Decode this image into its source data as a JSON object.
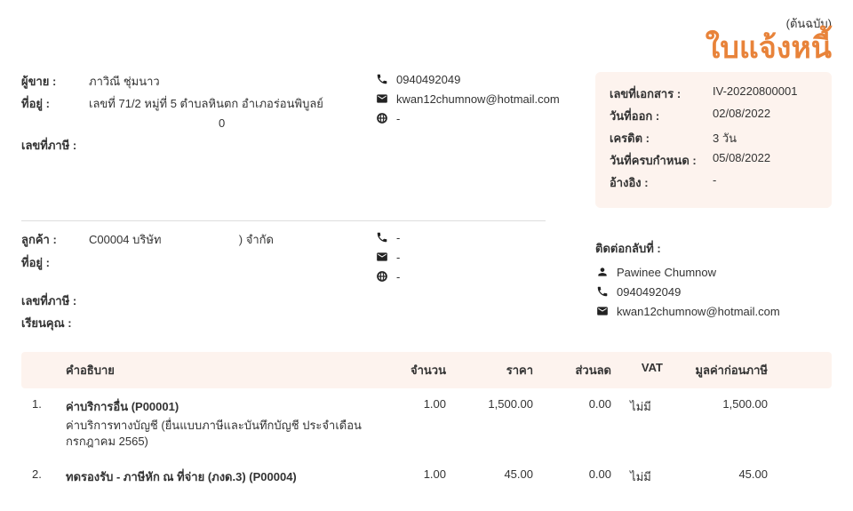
{
  "header": {
    "original": "(ต้นฉบับ)",
    "title": "ใบแจ้งหนี้"
  },
  "seller": {
    "labels": {
      "name": "ผู้ขาย :",
      "address": "ที่อยู่ :",
      "taxid": "เลขที่ภาษี :"
    },
    "name": "ภาวิณี ชุ่มนาว",
    "address_line1": "เลขที่ 71/2 หมู่ที่ 5 ตำบลหินตก อำเภอร่อนพิบูลย์",
    "address_line2_visible": "0",
    "phone": "0940492049",
    "email": "kwan12chumnow@hotmail.com",
    "web": "-"
  },
  "customer": {
    "labels": {
      "name": "ลูกค้า :",
      "address": "ที่อยู่ :",
      "taxid": "เลขที่ภาษี :",
      "attn": "เรียนคุณ :"
    },
    "name_prefix": "C00004 บริษัท",
    "name_suffix": ") จำกัด",
    "phone": "-",
    "email": "-",
    "web": "-"
  },
  "docinfo": {
    "labels": {
      "docno": "เลขที่เอกสาร :",
      "issue": "วันที่ออก :",
      "credit": "เครดิต :",
      "due": "วันที่ครบกำหนด :",
      "ref": "อ้างอิง :"
    },
    "docno": "IV-20220800001",
    "issue": "02/08/2022",
    "credit": "3 วัน",
    "due": "05/08/2022",
    "ref": "-"
  },
  "contactback": {
    "title": "ติดต่อกลับที่ :",
    "name": "Pawinee Chumnow",
    "phone": "0940492049",
    "email": "kwan12chumnow@hotmail.com"
  },
  "table": {
    "headers": {
      "desc": "คำอธิบาย",
      "qty": "จำนวน",
      "price": "ราคา",
      "discount": "ส่วนลด",
      "vat": "VAT",
      "pretax": "มูลค่าก่อนภาษี"
    },
    "rows": [
      {
        "idx": "1.",
        "name": "ค่าบริการอื่น (P00001)",
        "desc": "ค่าบริการทางบัญชี (ยื่นแบบภาษีและบันทึกบัญชี ประจำเดือนกรกฎาคม 2565)",
        "qty": "1.00",
        "price": "1,500.00",
        "discount": "0.00",
        "vat": "ไม่มี",
        "pretax": "1,500.00"
      },
      {
        "idx": "2.",
        "name": "ทดรองรับ - ภาษีหัก ณ ที่จ่าย (ภงด.3) (P00004)",
        "desc": "",
        "qty": "1.00",
        "price": "45.00",
        "discount": "0.00",
        "vat": "ไม่มี",
        "pretax": "45.00"
      }
    ]
  }
}
